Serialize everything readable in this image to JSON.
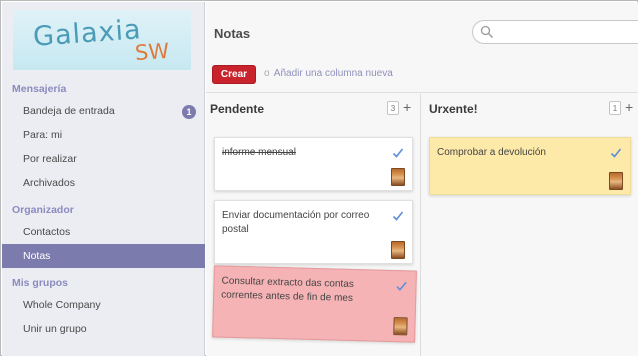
{
  "logo": {
    "main": "Galaxia",
    "sub": "SW"
  },
  "sidebar": {
    "sections": [
      {
        "heading": "Mensajería",
        "items": [
          {
            "label": "Bandeja de entrada",
            "badge": "1"
          },
          {
            "label": "Para: mi"
          },
          {
            "label": "Por realizar"
          },
          {
            "label": "Archivados"
          }
        ]
      },
      {
        "heading": "Organizador",
        "items": [
          {
            "label": "Contactos"
          },
          {
            "label": "Notas",
            "active": true
          }
        ]
      },
      {
        "heading": "Mis grupos",
        "items": [
          {
            "label": "Whole Company"
          },
          {
            "label": "Unir un grupo"
          }
        ]
      }
    ]
  },
  "header": {
    "title": "Notas",
    "search_placeholder": ""
  },
  "toolbar": {
    "create_label": "Crear",
    "or_text": "o",
    "add_column_label": "Añadir una columna nueva"
  },
  "columns": [
    {
      "title": "Pendente",
      "count": "3",
      "add": "+",
      "cards": [
        {
          "text": "informe mensual",
          "done": true
        },
        {
          "text": "Enviar documentación por correo postal",
          "done": false
        },
        {
          "text": "Consultar extracto das contas correntes antes de fin de mes",
          "done": false
        }
      ]
    },
    {
      "title": "Urxente!",
      "count": "1",
      "add": "+",
      "cards": [
        {
          "text": "Comprobar a devolución",
          "done": false
        }
      ]
    }
  ],
  "colors": {
    "sidebar_bg": "#ececf3",
    "accent": "#7c7bad",
    "create_button": "#c9242d",
    "card_red": "#f5b3b6",
    "card_yellow": "#fdeaa9",
    "check": "#5b8fd9"
  }
}
